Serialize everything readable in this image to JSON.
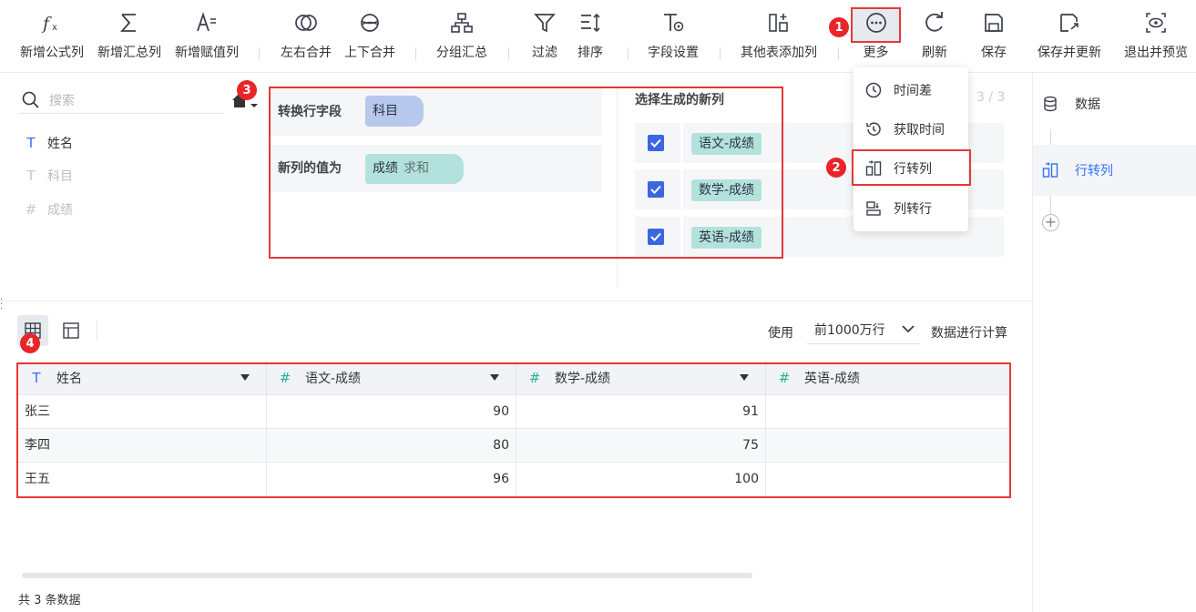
{
  "toolbar": {
    "items": [
      {
        "label": "新增公式列",
        "icon": "formula-icon"
      },
      {
        "label": "新增汇总列",
        "icon": "sigma-icon"
      },
      {
        "label": "新增赋值列",
        "icon": "assign-icon"
      },
      {
        "label": "左右合并",
        "icon": "merge-horizontal-icon"
      },
      {
        "label": "上下合并",
        "icon": "merge-vertical-icon"
      },
      {
        "label": "分组汇总",
        "icon": "group-icon"
      },
      {
        "label": "过滤",
        "icon": "filter-icon"
      },
      {
        "label": "排序",
        "icon": "sort-icon"
      },
      {
        "label": "字段设置",
        "icon": "field-settings-icon"
      },
      {
        "label": "其他表添加列",
        "icon": "add-column-icon"
      },
      {
        "label": "更多",
        "icon": "more-icon"
      },
      {
        "label": "刷新",
        "icon": "refresh-icon"
      },
      {
        "label": "保存",
        "icon": "save-icon"
      },
      {
        "label": "保存并更新",
        "icon": "save-update-icon"
      },
      {
        "label": "退出并预览",
        "icon": "preview-icon"
      }
    ]
  },
  "badges": {
    "b1": "1",
    "b2": "2",
    "b3": "3",
    "b4": "4"
  },
  "field_panel": {
    "search_placeholder": "搜索",
    "fields": [
      {
        "label": "姓名",
        "type": "T"
      },
      {
        "label": "科目",
        "type": "T"
      },
      {
        "label": "成绩",
        "type": "#"
      }
    ]
  },
  "config": {
    "transform_label": "转换行字段",
    "transform_value": "科目",
    "newvalue_label": "新列的值为",
    "newvalue_field": "成绩",
    "newvalue_agg": "求和",
    "select_title": "选择生成的新列",
    "select_count": "3 / 3",
    "new_columns": [
      "语文-成绩",
      "数学-成绩",
      "英语-成绩"
    ]
  },
  "more_menu": {
    "items": [
      {
        "label": "时间差",
        "icon": "time-diff-icon"
      },
      {
        "label": "获取时间",
        "icon": "get-time-icon"
      },
      {
        "label": "行转列",
        "icon": "row-to-column-icon"
      },
      {
        "label": "列转行",
        "icon": "column-to-row-icon"
      }
    ]
  },
  "right_panel": {
    "items": [
      {
        "label": "数据",
        "icon": "database-icon"
      },
      {
        "label": "行转列",
        "icon": "row-to-column-icon"
      }
    ]
  },
  "preview": {
    "use_label": "使用",
    "row_limit": "前1000万行",
    "calc_label": "数据进行计算",
    "columns": [
      {
        "label": "姓名",
        "type": "T"
      },
      {
        "label": "语文-成绩",
        "type": "#"
      },
      {
        "label": "数学-成绩",
        "type": "#"
      },
      {
        "label": "英语-成绩",
        "type": "#"
      }
    ],
    "rows": [
      [
        "张三",
        "90",
        "91",
        ""
      ],
      [
        "李四",
        "80",
        "75",
        ""
      ],
      [
        "王五",
        "96",
        "100",
        ""
      ]
    ],
    "total_text": "共 3 条数据"
  },
  "colors": {
    "accent": "#3370ff",
    "highlight": "#e53935",
    "teal": "#b3e2dc",
    "blue_chip": "#b6c8ec"
  }
}
